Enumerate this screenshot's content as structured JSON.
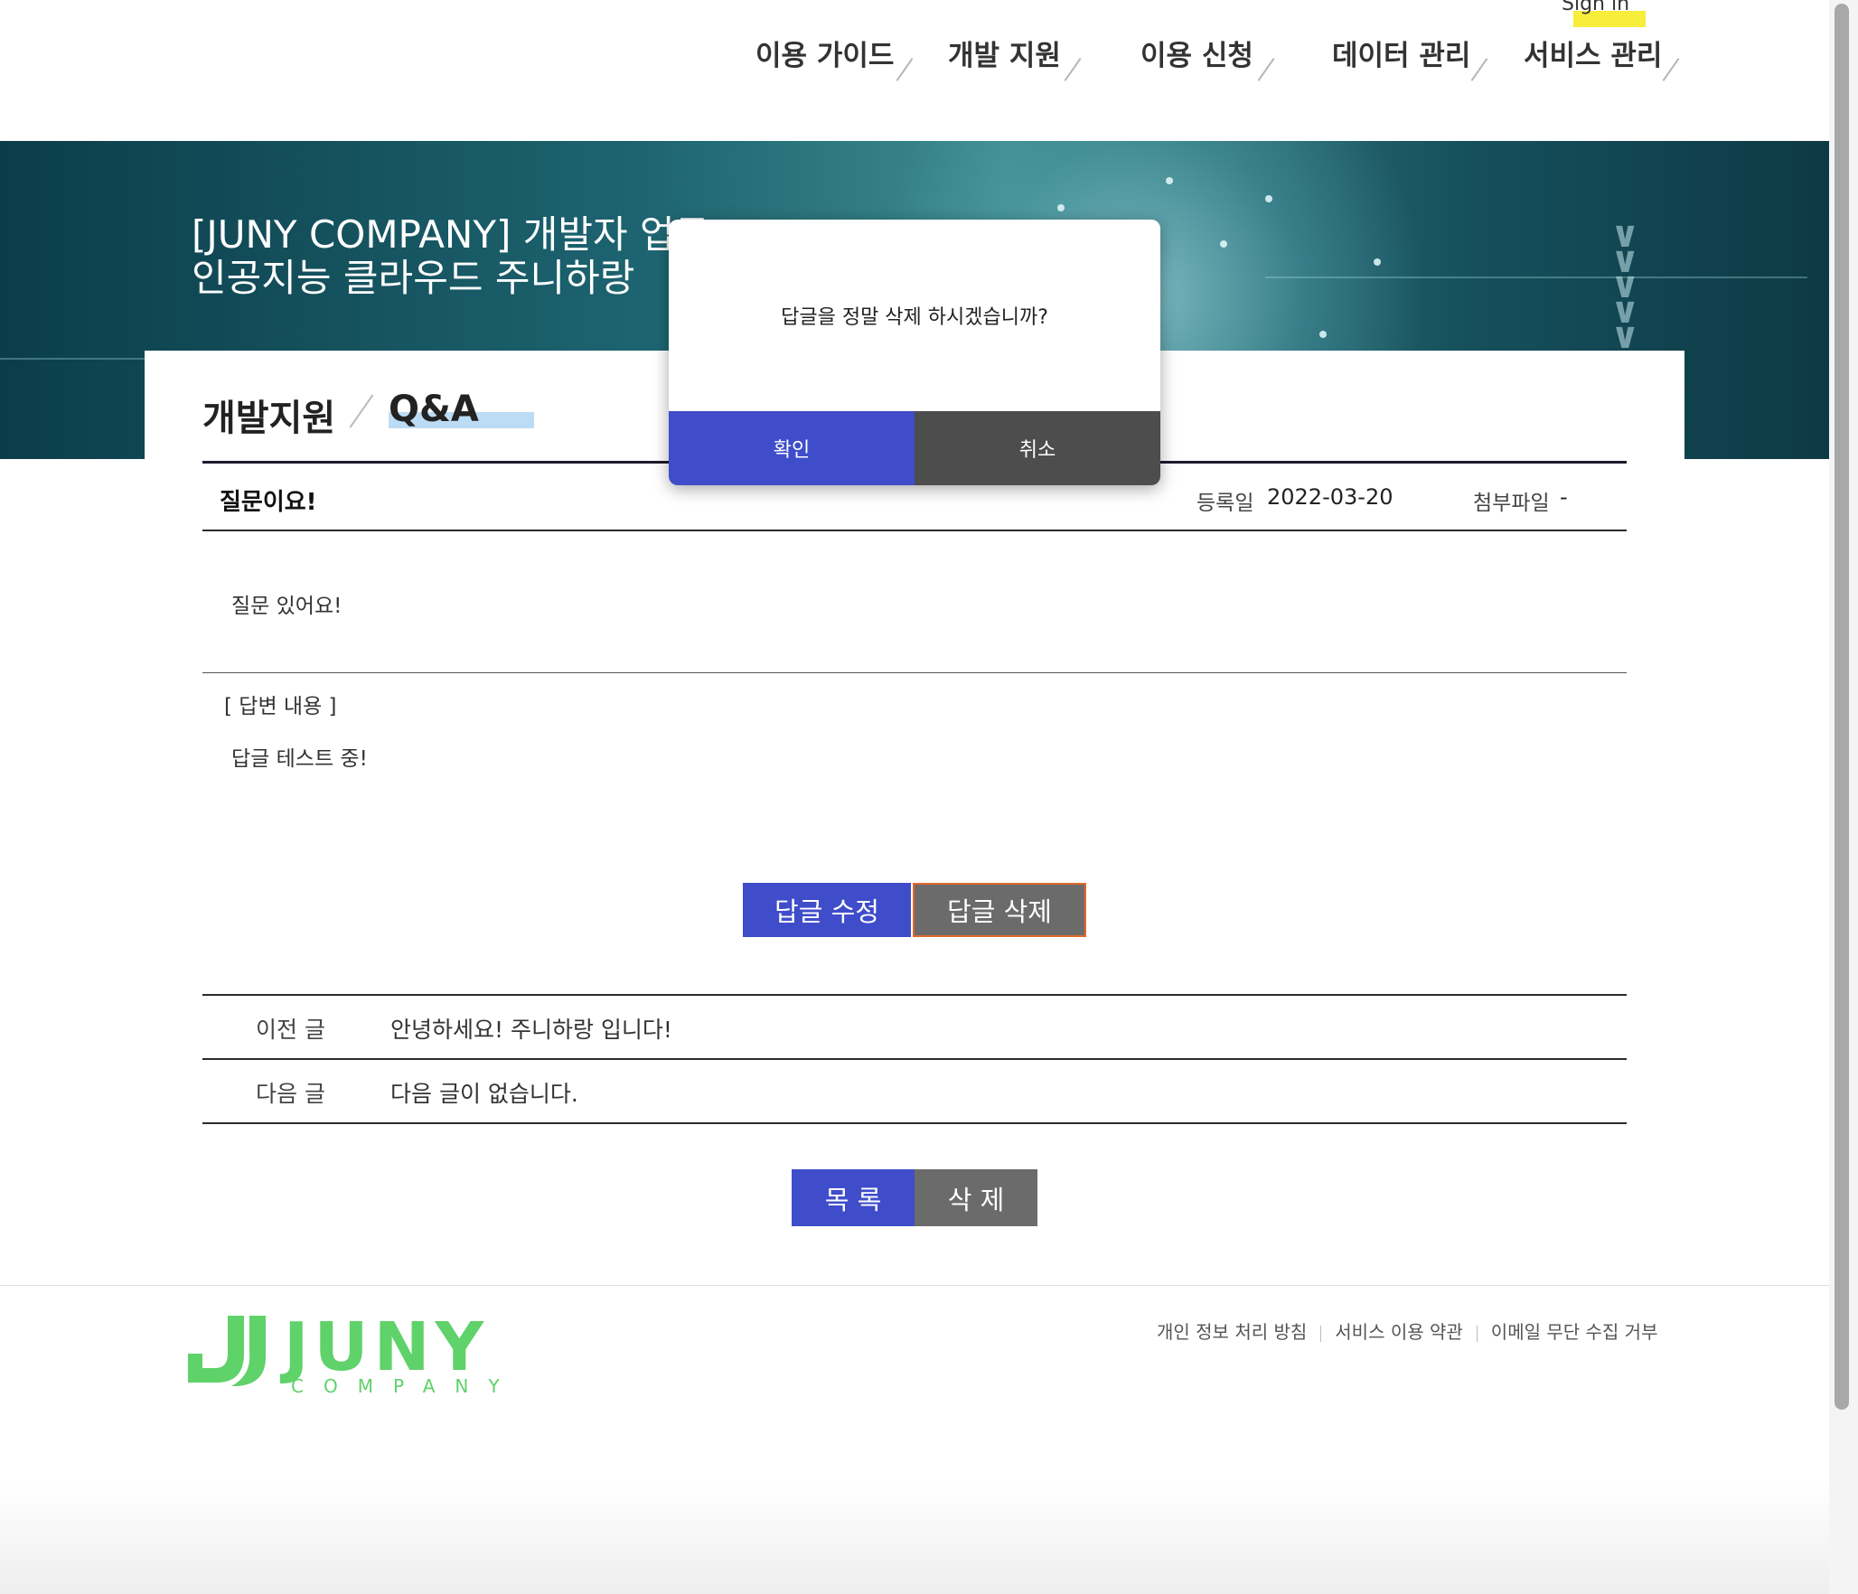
{
  "header": {
    "signin_label": "Sign in",
    "nav": [
      "이용 가이드",
      "개발 지원",
      "이용 신청",
      "데이터 관리",
      "서비스 관리"
    ]
  },
  "banner": {
    "line1": "[JUNY COMPANY] 개발자 업무",
    "line2": "인공지능 클라우드 주니하랑"
  },
  "breadcrumb": {
    "section": "개발지원",
    "page": "Q&A"
  },
  "post": {
    "title": "질문이요!",
    "date_label": "등록일",
    "date": "2022-03-20",
    "attach_label": "첨부파일",
    "attach_value": "-",
    "body": "질문 있어요!",
    "answer_heading": "[ 답변 내용 ]",
    "answer_body": "답글 테스트 중!"
  },
  "answer_buttons": {
    "edit": "답글 수정",
    "delete": "답글 삭제"
  },
  "post_nav": {
    "prev_label": "이전 글",
    "prev_title": "안녕하세요! 주니하랑 입니다!",
    "next_label": "다음 글",
    "next_title": "다음 글이 없습니다."
  },
  "bottom_buttons": {
    "list": "목 록",
    "delete": "삭 제"
  },
  "footer": {
    "logo_word": "JUNY",
    "logo_sub": "COMPANY",
    "links": [
      "개인 정보 처리 방침",
      "서비스 이용 약관",
      "이메일 무단 수집 거부"
    ]
  },
  "modal": {
    "message": "답글을 정말 삭제 하시겠습니까?",
    "confirm": "확인",
    "cancel": "취소"
  },
  "colors": {
    "primary": "#3f4dca",
    "secondary": "#6b6b6b",
    "logo": "#5fd26a"
  }
}
